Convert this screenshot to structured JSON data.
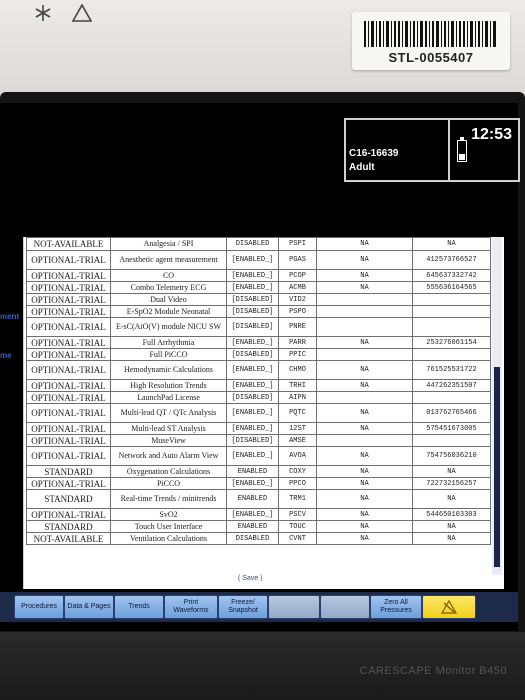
{
  "device": {
    "asset_id": "STL-0055407",
    "brand": "CARESCAPE Monitor B450"
  },
  "header": {
    "bed": "C16-16639",
    "patient_category": "Adult",
    "time": "12:53"
  },
  "side_labels": [
    "ment",
    "me"
  ],
  "license_table": {
    "rows": [
      {
        "status": "NOT-AVAILABLE",
        "option": "Analgesia / SPI",
        "state": "DISABLED",
        "code": "PSPI",
        "count": "NA",
        "key": "NA"
      },
      {
        "status": "OPTIONAL-TRIAL",
        "option": "Anesthetic agent measurement",
        "state": "[ENABLED_]",
        "code": "PGAS",
        "count": "NA",
        "key": "412573766527"
      },
      {
        "status": "OPTIONAL-TRIAL",
        "option": "CO",
        "state": "[ENABLED_]",
        "code": "PCOP",
        "count": "NA",
        "key": "645637332742"
      },
      {
        "status": "OPTIONAL-TRIAL",
        "option": "Combo Telemetry ECG",
        "state": "[ENABLED_]",
        "code": "ACMB",
        "count": "NA",
        "key": "555636164565"
      },
      {
        "status": "OPTIONAL-TRIAL",
        "option": "Dual Video",
        "state": "[DISABLED]",
        "code": "VID2",
        "count": "",
        "key": ""
      },
      {
        "status": "OPTIONAL-TRIAL",
        "option": "E-SpO2 Module Neonatal",
        "state": "[DISABLED]",
        "code": "PSPO",
        "count": "",
        "key": ""
      },
      {
        "status": "OPTIONAL-TRIAL",
        "option": "E-sC(AiO(V) module NICU SW",
        "state": "[DISABLED]",
        "code": "PNRE",
        "count": "",
        "key": ""
      },
      {
        "status": "OPTIONAL-TRIAL",
        "option": "Full Arrhythmia",
        "state": "[ENABLED_]",
        "code": "PARR",
        "count": "NA",
        "key": "253276061154"
      },
      {
        "status": "OPTIONAL-TRIAL",
        "option": "Full PiCCO",
        "state": "[DISABLED]",
        "code": "PPIC",
        "count": "",
        "key": ""
      },
      {
        "status": "OPTIONAL-TRIAL",
        "option": "Hemodynamic Calculations",
        "state": "[ENABLED_]",
        "code": "CHMO",
        "count": "NA",
        "key": "761525531722"
      },
      {
        "status": "OPTIONAL-TRIAL",
        "option": "High Resolution Trends",
        "state": "[ENABLED_]",
        "code": "TRHI",
        "count": "NA",
        "key": "447262351507"
      },
      {
        "status": "OPTIONAL-TRIAL",
        "option": "LaunchPad License",
        "state": "[DISABLED]",
        "code": "AIPN",
        "count": "",
        "key": ""
      },
      {
        "status": "OPTIONAL-TRIAL",
        "option": "Multi-lead QT / QTc Analysis",
        "state": "[ENABLED_]",
        "code": "PQTC",
        "count": "NA",
        "key": "013762765466"
      },
      {
        "status": "OPTIONAL-TRIAL",
        "option": "Multi-lead ST Analysis",
        "state": "[ENABLED_]",
        "code": "12ST",
        "count": "NA",
        "key": "575451673005"
      },
      {
        "status": "OPTIONAL-TRIAL",
        "option": "MuseView",
        "state": "[DISABLED]",
        "code": "AMSE",
        "count": "",
        "key": ""
      },
      {
        "status": "OPTIONAL-TRIAL",
        "option": "Network and Auto Alarm View",
        "state": "[ENABLED_]",
        "code": "AVOA",
        "count": "NA",
        "key": "754756036210"
      },
      {
        "status": "STANDARD",
        "option": "Oxygenation Calculations",
        "state": "ENABLED",
        "code": "COXY",
        "count": "NA",
        "key": "NA"
      },
      {
        "status": "OPTIONAL-TRIAL",
        "option": "PiCCO",
        "state": "[ENABLED_]",
        "code": "PPCO",
        "count": "NA",
        "key": "722732156257"
      },
      {
        "status": "STANDARD",
        "option": "Real-time Trends / minitrends",
        "state": "ENABLED",
        "code": "TRM1",
        "count": "NA",
        "key": "NA"
      },
      {
        "status": "OPTIONAL-TRIAL",
        "option": "SvO2",
        "state": "[ENABLED_]",
        "code": "PSCV",
        "count": "NA",
        "key": "544650103303"
      },
      {
        "status": "STANDARD",
        "option": "Touch User Interface",
        "state": "ENABLED",
        "code": "TOUC",
        "count": "NA",
        "key": "NA"
      },
      {
        "status": "NOT-AVAILABLE",
        "option": "Ventilation Calculations",
        "state": "DISABLED",
        "code": "CVNT",
        "count": "NA",
        "key": "NA"
      }
    ],
    "save_label": "( Save )"
  },
  "buttons": {
    "procedures": "Procedures",
    "data_pages": "Data & Pages",
    "trends": "Trends",
    "print_waveforms": "Print Waveforms",
    "freeze_snapshot": "Freeze/ Snapshot",
    "zero_all": "Zero All Pressures"
  },
  "colors": {
    "button_blue": "#7eabe3",
    "alarm_yellow": "#f5d824",
    "bar_navy": "#1e2a4a"
  }
}
